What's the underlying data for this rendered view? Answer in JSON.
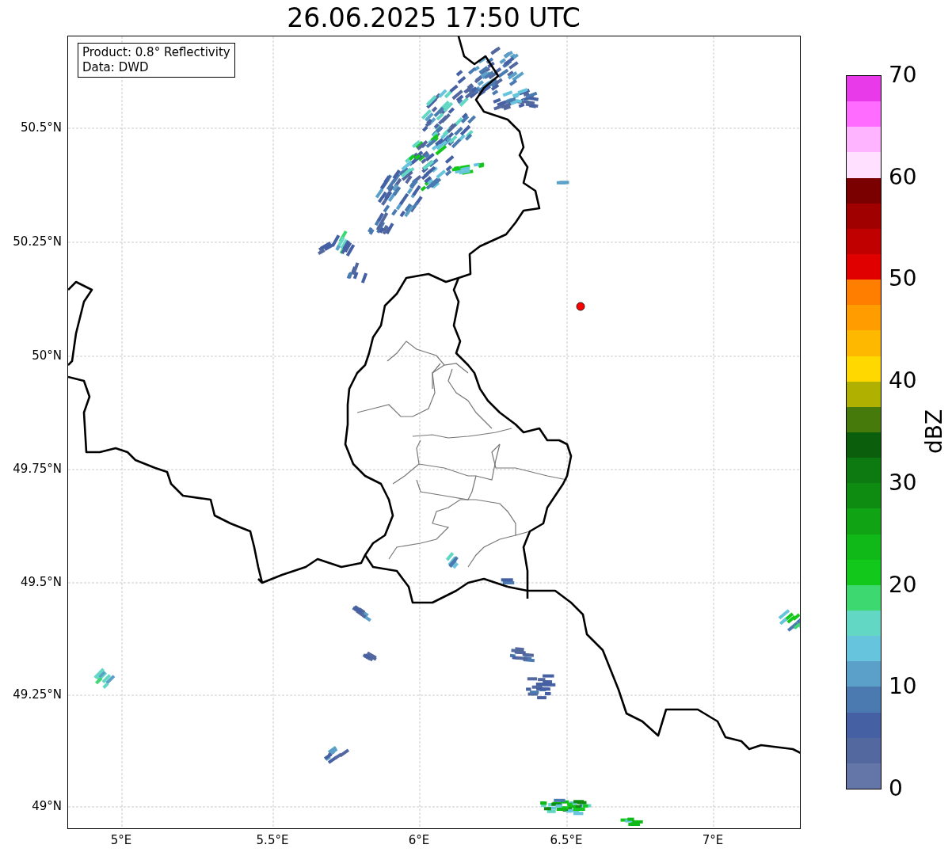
{
  "title": "26.06.2025 17:50 UTC",
  "info_box": [
    "Product: 0.8° Reflectivity",
    "Data: DWD"
  ],
  "latitude_labels": [
    "50.5°N",
    "50.25°N",
    "50°N",
    "49.75°N",
    "49.5°N",
    "49.25°N",
    "49°N"
  ],
  "longitude_labels": [
    "5°E",
    "5.5°E",
    "6°E",
    "6.5°E",
    "7°E"
  ],
  "colorbar": {
    "label": "dBZ",
    "ticks": [
      "70",
      "60",
      "50",
      "40",
      "30",
      "20",
      "10",
      "0"
    ],
    "bands": [
      {
        "color": "#6475a8"
      },
      {
        "color": "#5468a0"
      },
      {
        "color": "#4561a4"
      },
      {
        "color": "#4a7ab0"
      },
      {
        "color": "#5aa0c8"
      },
      {
        "color": "#66c4dc"
      },
      {
        "color": "#62d8c4"
      },
      {
        "color": "#3ed870"
      },
      {
        "color": "#12c81a"
      },
      {
        "color": "#10b818"
      },
      {
        "color": "#10a414"
      },
      {
        "color": "#0e8c12"
      },
      {
        "color": "#0c7a10"
      },
      {
        "color": "#0a5e0c"
      },
      {
        "color": "#467a0a"
      },
      {
        "color": "#b0b000"
      },
      {
        "color": "#ffd800"
      },
      {
        "color": "#ffb800"
      },
      {
        "color": "#ff9c00"
      },
      {
        "color": "#ff7e00"
      },
      {
        "color": "#e00000"
      },
      {
        "color": "#c00000"
      },
      {
        "color": "#a00000"
      },
      {
        "color": "#7a0000"
      },
      {
        "color": "#ffe0ff"
      },
      {
        "color": "#ffb4ff"
      },
      {
        "color": "#ff6cff"
      },
      {
        "color": "#e83ae8"
      }
    ]
  }
}
